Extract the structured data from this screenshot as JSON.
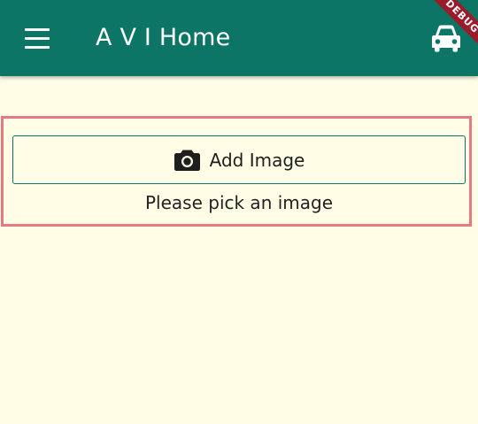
{
  "app_bar": {
    "title": "A V I Home",
    "menu_icon": "hamburger-menu-icon",
    "action_icon": "car-icon",
    "background_color": "#0d7565",
    "debug_banner": "DEBUG"
  },
  "content": {
    "add_image_button": {
      "label": "Add Image",
      "icon": "camera-icon",
      "border_color": "#0d7565"
    },
    "hint_text": "Please pick an image",
    "background_color": "#fffde6",
    "highlight_color": "#e77a80"
  }
}
